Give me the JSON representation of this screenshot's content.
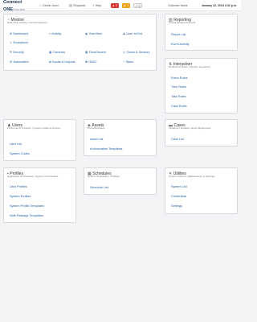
{
  "header": {
    "logo_line1": "Connect",
    "logo_line2": "ONE",
    "logo_suffix": "Extended",
    "nav": [
      {
        "label": "Cardin Journ",
        "icon": "home-icon"
      },
      {
        "label": "Requests",
        "icon": "clipboard-icon"
      },
      {
        "label": "Help",
        "icon": "question-icon"
      }
    ],
    "badges": [
      {
        "value": "3",
        "color": "#d9332e",
        "icon": "bell-icon"
      },
      {
        "value": "1",
        "color": "#f0a21a",
        "icon": "warning-icon"
      },
      {
        "value": "0",
        "color": "#f5f5f5",
        "icon": "check-icon"
      }
    ],
    "customer_label": "Customer Name",
    "datetime": "January 22, 2024 2:32 p.m."
  },
  "panels": {
    "monitor": {
      "title": "Monitor",
      "subtitle": "Real-Time Activity | Control Systems",
      "items": [
        {
          "label": "Dashboard",
          "icon": "dashboard-icon"
        },
        {
          "label": "Activity",
          "icon": "activity-icon"
        },
        {
          "label": "OverView",
          "icon": "overview-icon"
        },
        {
          "label": "User In/Out",
          "icon": "user-icon"
        },
        {
          "label": "Exceptions",
          "icon": "exception-icon"
        },
        {
          "label": "Security",
          "icon": "security-icon"
        },
        {
          "label": "Cameras",
          "icon": "camera-icon"
        },
        {
          "label": "FloorDiscern",
          "icon": "floor-icon"
        },
        {
          "label": "Zones & Sensors",
          "icon": "sensor-icon"
        },
        {
          "label": "Automation",
          "icon": "automation-icon"
        },
        {
          "label": "Inputs & Outputs",
          "icon": "io-icon"
        },
        {
          "label": "HVAC",
          "icon": "hvac-icon"
        },
        {
          "label": "Tasks",
          "icon": "task-icon"
        }
      ]
    },
    "reporting": {
      "title": "Reporting",
      "subtitle": "Create Detailed Reports",
      "items": [
        {
          "label": "Report List"
        },
        {
          "label": "Event Activity"
        }
      ]
    },
    "interaction": {
      "title": "Interaction",
      "subtitle": "Notification Rules | System Interaction",
      "items": [
        {
          "label": "Event Rules"
        },
        {
          "label": "Time Rules"
        },
        {
          "label": "Task Rules"
        },
        {
          "label": "Case Rules"
        }
      ]
    },
    "users": {
      "title": "Users",
      "subtitle": "Personnel & Contacts | System Codes & Access",
      "items": [
        {
          "label": "User List"
        },
        {
          "label": "System Codes"
        }
      ]
    },
    "assets": {
      "title": "Assets",
      "subtitle": "Physical Assets",
      "items": [
        {
          "label": "Asset List"
        },
        {
          "label": "Authorization Templates"
        }
      ]
    },
    "cases": {
      "title": "Cases",
      "subtitle": "Incidents | Repairs | Event Responses",
      "items": [
        {
          "label": "Case List"
        }
      ]
    },
    "profiles": {
      "title": "Profiles",
      "subtitle": "Application Permissions | System Permissions",
      "items": [
        {
          "label": "User Profiles"
        },
        {
          "label": "System Profiles"
        },
        {
          "label": "System Profile Templates"
        },
        {
          "label": "Safe Passage Templates"
        }
      ]
    },
    "schedules": {
      "title": "Schedules",
      "subtitle": "System Schedules | Holidays",
      "items": [
        {
          "label": "Schedule List"
        }
      ]
    },
    "utilities": {
      "title": "Utilities",
      "subtitle": "System Options | Maintenance & Settings",
      "items": [
        {
          "label": "System List"
        },
        {
          "label": "Credentials"
        },
        {
          "label": "Settings"
        }
      ]
    }
  }
}
